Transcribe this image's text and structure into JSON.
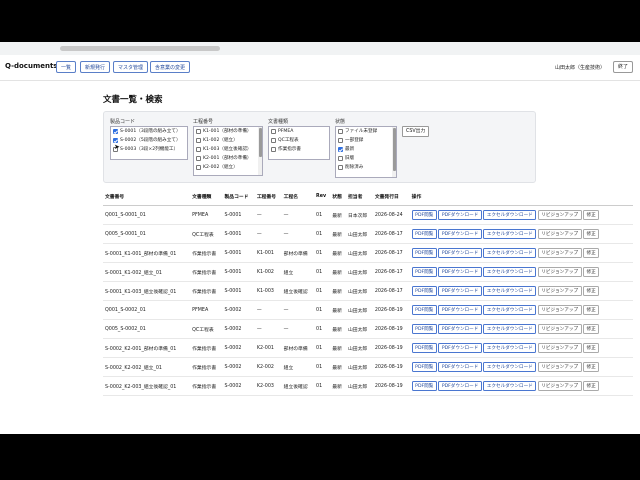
{
  "app": {
    "brand": "Q-documents"
  },
  "nav": [
    "一覧",
    "新規発行",
    "マスタ管理",
    "含意業の変更"
  ],
  "user": {
    "name": "山田太郎（生産技術）",
    "logout": "終了"
  },
  "page_title": "文書一覧・検索",
  "filters": {
    "product": {
      "label": "製品コード",
      "options": [
        {
          "text": "S-0001（3段階の組み立て）",
          "checked": true
        },
        {
          "text": "S-0002（5段階の組み立て）",
          "checked": true
        },
        {
          "text": "S-0003（3段×2列機能工）",
          "checked": false
        }
      ]
    },
    "process": {
      "label": "工程番号",
      "options": [
        {
          "text": "K1-001（部材の準備）",
          "checked": false
        },
        {
          "text": "K1-002（組立）",
          "checked": false
        },
        {
          "text": "K1-003（組立後確認）",
          "checked": false
        },
        {
          "text": "K2-001（部材の準備）",
          "checked": false
        },
        {
          "text": "K2-002（組立）",
          "checked": false
        }
      ]
    },
    "doctype": {
      "label": "文書種類",
      "options": [
        {
          "text": "PFMEA",
          "checked": false
        },
        {
          "text": "QC工程表",
          "checked": false
        },
        {
          "text": "作業指示書",
          "checked": false
        }
      ]
    },
    "status": {
      "label": "状態",
      "options": [
        {
          "text": "ファイル未登録",
          "checked": false
        },
        {
          "text": "一部登録",
          "checked": false
        },
        {
          "text": "最新",
          "checked": true
        },
        {
          "text": "旧版",
          "checked": false
        },
        {
          "text": "削除済み",
          "checked": false
        }
      ]
    },
    "csv_label": "CSV出力"
  },
  "table": {
    "headers": [
      "文書番号",
      "文書種類",
      "製品コード",
      "工程番号",
      "工程名",
      "Rev",
      "状態",
      "担当者",
      "文書発行日",
      "操作"
    ],
    "actions": {
      "pdf_view": "PDF閲覧",
      "pdf_dl": "PDFダウンロード",
      "excel_dl": "エクセルダウンロード",
      "revup": "リビジョンアップ",
      "edit": "修正"
    },
    "rows": [
      [
        "Q001_S-0001_01",
        "PFMEA",
        "S-0001",
        "—",
        "—",
        "01",
        "最新",
        "日本次郎",
        "2026-08-24"
      ],
      [
        "Q005_S-0001_01",
        "QC工程表",
        "S-0001",
        "—",
        "—",
        "01",
        "最新",
        "山田太郎",
        "2026-08-17"
      ],
      [
        "S-0001_K1-001_部材の準備_01",
        "作業指示書",
        "S-0001",
        "K1-001",
        "部材の準備",
        "01",
        "最新",
        "山田太郎",
        "2026-08-17"
      ],
      [
        "S-0001_K1-002_組立_01",
        "作業指示書",
        "S-0001",
        "K1-002",
        "組立",
        "01",
        "最新",
        "山田太郎",
        "2026-08-17"
      ],
      [
        "S-0001_K1-003_組立後確認_01",
        "作業指示書",
        "S-0001",
        "K1-003",
        "組立後確認",
        "01",
        "最新",
        "山田太郎",
        "2026-08-17"
      ],
      [
        "Q001_S-0002_01",
        "PFMEA",
        "S-0002",
        "—",
        "—",
        "01",
        "最新",
        "山田太郎",
        "2026-08-19"
      ],
      [
        "Q005_S-0002_01",
        "QC工程表",
        "S-0002",
        "—",
        "—",
        "01",
        "最新",
        "山田太郎",
        "2026-08-19"
      ],
      [
        "S-0002_K2-001_部材の準備_01",
        "作業指示書",
        "S-0002",
        "K2-001",
        "部材の準備",
        "01",
        "最新",
        "山田太郎",
        "2026-08-19"
      ],
      [
        "S-0002_K2-002_組立_01",
        "作業指示書",
        "S-0002",
        "K2-002",
        "組立",
        "01",
        "最新",
        "山田太郎",
        "2026-08-19"
      ],
      [
        "S-0002_K2-003_組立後確認_01",
        "作業指示書",
        "S-0002",
        "K2-003",
        "組立後確認",
        "01",
        "最新",
        "山田太郎",
        "2026-08-19"
      ]
    ]
  }
}
